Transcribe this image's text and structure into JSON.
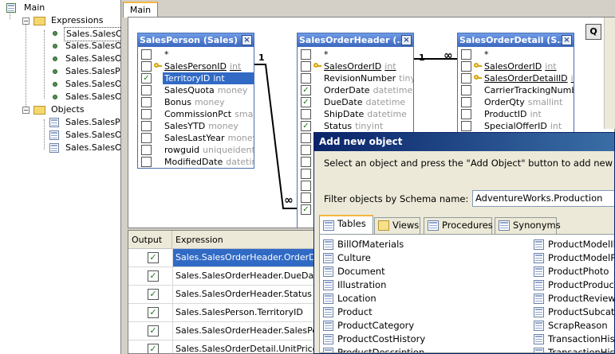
{
  "tree": {
    "root": "Main",
    "expressions_label": "Expressions",
    "expressions": [
      "Sales.SalesOr",
      "Sales.SalesOr",
      "Sales.SalesOr",
      "Sales.SalesPe",
      "Sales.SalesOr",
      "Sales.SalesOr"
    ],
    "objects_label": "Objects",
    "objects": [
      "Sales.SalesPe",
      "Sales.SalesOr",
      "Sales.SalesOr"
    ]
  },
  "tab": {
    "main_label": "Main"
  },
  "zoom_label": "Q",
  "tables": {
    "salesperson": {
      "title": "SalesPerson (Sales)",
      "fields": [
        {
          "name": "*",
          "type": "",
          "checked": false,
          "key": false
        },
        {
          "name": "SalesPersonID",
          "type": "int",
          "checked": false,
          "key": true
        },
        {
          "name": "TerritoryID",
          "type": "int",
          "checked": true,
          "key": false,
          "selected": true
        },
        {
          "name": "SalesQuota",
          "type": "money",
          "checked": false,
          "key": false
        },
        {
          "name": "Bonus",
          "type": "money",
          "checked": false,
          "key": false
        },
        {
          "name": "CommissionPct",
          "type": "smallmo",
          "checked": false,
          "key": false
        },
        {
          "name": "SalesYTD",
          "type": "money",
          "checked": false,
          "key": false
        },
        {
          "name": "SalesLastYear",
          "type": "money",
          "checked": false,
          "key": false
        },
        {
          "name": "rowguid",
          "type": "uniqueidentifie",
          "checked": false,
          "key": false
        },
        {
          "name": "ModifiedDate",
          "type": "datetime",
          "checked": false,
          "key": false
        }
      ]
    },
    "salesorderheader": {
      "title": "SalesOrderHeader (...",
      "fields": [
        {
          "name": "*",
          "type": "",
          "checked": false,
          "key": false
        },
        {
          "name": "SalesOrderID",
          "type": "int",
          "checked": false,
          "key": true
        },
        {
          "name": "RevisionNumber",
          "type": "tinyint",
          "checked": false,
          "key": false
        },
        {
          "name": "OrderDate",
          "type": "datetime",
          "checked": true,
          "key": false
        },
        {
          "name": "DueDate",
          "type": "datetime",
          "checked": true,
          "key": false
        },
        {
          "name": "ShipDate",
          "type": "datetime",
          "checked": false,
          "key": false
        },
        {
          "name": "Status",
          "type": "tinyint",
          "checked": true,
          "key": false
        }
      ]
    },
    "salesorderdetail": {
      "title": "SalesOrderDetail (S...",
      "fields": [
        {
          "name": "*",
          "type": "",
          "checked": false,
          "key": false
        },
        {
          "name": "SalesOrderID",
          "type": "int",
          "checked": false,
          "key": true
        },
        {
          "name": "SalesOrderDetailID",
          "type": "int",
          "checked": false,
          "key": true
        },
        {
          "name": "CarrierTrackingNumber",
          "type": "",
          "checked": false,
          "key": false
        },
        {
          "name": "OrderQty",
          "type": "smallint",
          "checked": false,
          "key": false
        },
        {
          "name": "ProductID",
          "type": "int",
          "checked": false,
          "key": false
        },
        {
          "name": "SpecialOfferID",
          "type": "int",
          "checked": false,
          "key": false
        }
      ]
    }
  },
  "relations": {
    "one_a": "1",
    "many_a": "∞",
    "one_b": "1",
    "many_b": "∞"
  },
  "grid": {
    "col_output": "Output",
    "col_expression": "Expression",
    "rows": [
      {
        "expr": "Sales.SalesOrderHeader.OrderDate",
        "checked": true,
        "selected": true
      },
      {
        "expr": "Sales.SalesOrderHeader.DueDate",
        "checked": true,
        "selected": false
      },
      {
        "expr": "Sales.SalesOrderHeader.Status",
        "checked": true,
        "selected": false
      },
      {
        "expr": "Sales.SalesPerson.TerritoryID",
        "checked": true,
        "selected": false
      },
      {
        "expr": "Sales.SalesOrderHeader.SalesPer...",
        "checked": true,
        "selected": false
      },
      {
        "expr": "Sales.SalesOrderDetail.UnitPrice",
        "checked": true,
        "selected": false
      }
    ]
  },
  "dialog": {
    "title": "Add new object",
    "description": "Select an object and press the \"Add Object\" button to add new object to the c",
    "filter_label": "Filter objects by Schema name:",
    "filter_value": "AdventureWorks.Production",
    "tabs": [
      "Tables",
      "Views",
      "Procedures",
      "Synonyms"
    ],
    "col1": [
      "BillOfMaterials",
      "Culture",
      "Document",
      "Illustration",
      "Location",
      "Product",
      "ProductCategory",
      "ProductCostHistory",
      "ProductDescription"
    ],
    "col2": [
      "ProductModelIllu",
      "ProductModelPro",
      "ProductPhoto",
      "ProductProductP",
      "ProductReview",
      "ProductSubcateg",
      "ScrapReason",
      "TransactionHisto",
      "TransactionHisto"
    ]
  }
}
